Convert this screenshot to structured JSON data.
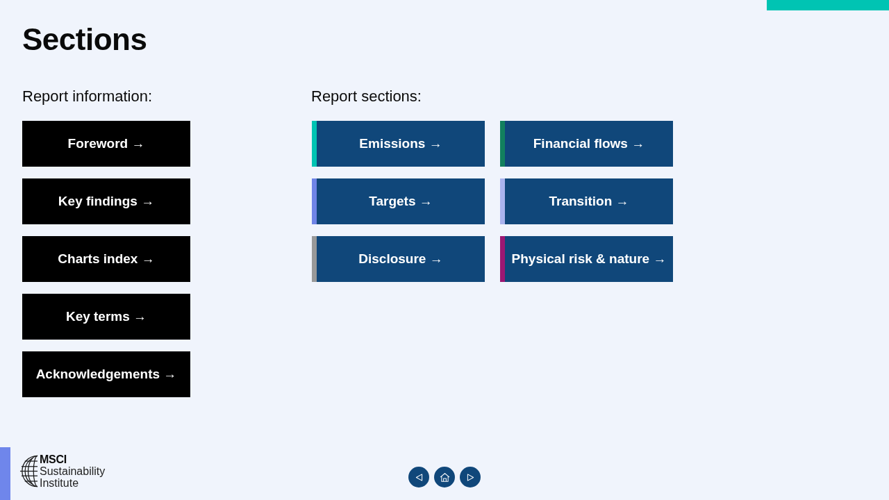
{
  "title": "Sections",
  "report_information": {
    "heading": "Report information:",
    "links": [
      {
        "label": "Foreword →"
      },
      {
        "label": "Key findings →"
      },
      {
        "label": "Charts index →"
      },
      {
        "label": "Key terms →"
      },
      {
        "label": "Acknowledgements →"
      }
    ]
  },
  "report_sections": {
    "heading": "Report sections:",
    "links": [
      {
        "label": "Emissions →",
        "color": "#00c4b3"
      },
      {
        "label": "Financial flows →",
        "color": "#12805e"
      },
      {
        "label": "Targets →",
        "color": "#6f84e6"
      },
      {
        "label": "Transition →",
        "color": "#aab3ee"
      },
      {
        "label": "Disclosure →",
        "color": "#999999"
      },
      {
        "label": "Physical risk & nature →",
        "color": "#9c1873"
      }
    ]
  },
  "logo": {
    "name": "MSCI",
    "subtitle_lines": [
      "Sustainability",
      "Institute"
    ]
  },
  "navigation": [
    {
      "kind": "previous"
    },
    {
      "kind": "home"
    },
    {
      "kind": "next"
    }
  ]
}
